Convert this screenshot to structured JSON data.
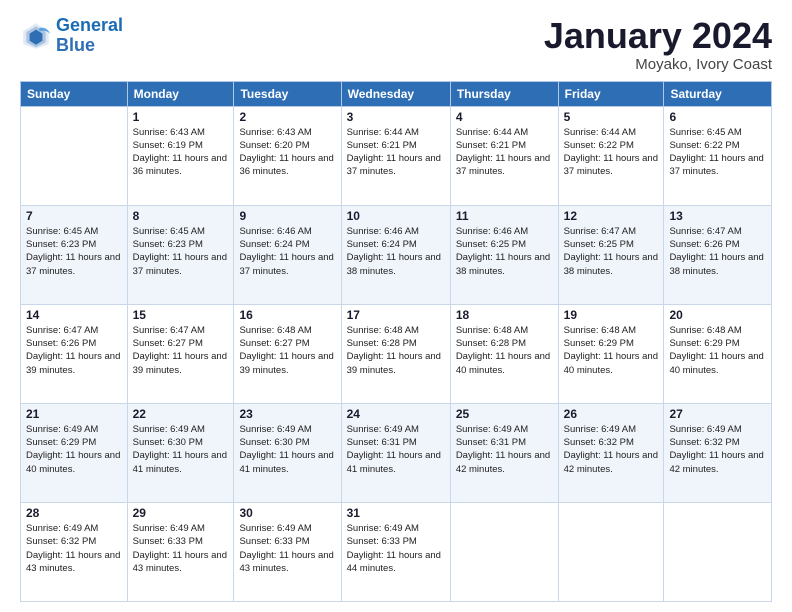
{
  "header": {
    "logo_line1": "General",
    "logo_line2": "Blue",
    "main_title": "January 2024",
    "subtitle": "Moyako, Ivory Coast"
  },
  "days_of_week": [
    "Sunday",
    "Monday",
    "Tuesday",
    "Wednesday",
    "Thursday",
    "Friday",
    "Saturday"
  ],
  "weeks": [
    [
      {
        "day": "",
        "sunrise": "",
        "sunset": "",
        "daylight": ""
      },
      {
        "day": "1",
        "sunrise": "Sunrise: 6:43 AM",
        "sunset": "Sunset: 6:19 PM",
        "daylight": "Daylight: 11 hours and 36 minutes."
      },
      {
        "day": "2",
        "sunrise": "Sunrise: 6:43 AM",
        "sunset": "Sunset: 6:20 PM",
        "daylight": "Daylight: 11 hours and 36 minutes."
      },
      {
        "day": "3",
        "sunrise": "Sunrise: 6:44 AM",
        "sunset": "Sunset: 6:21 PM",
        "daylight": "Daylight: 11 hours and 37 minutes."
      },
      {
        "day": "4",
        "sunrise": "Sunrise: 6:44 AM",
        "sunset": "Sunset: 6:21 PM",
        "daylight": "Daylight: 11 hours and 37 minutes."
      },
      {
        "day": "5",
        "sunrise": "Sunrise: 6:44 AM",
        "sunset": "Sunset: 6:22 PM",
        "daylight": "Daylight: 11 hours and 37 minutes."
      },
      {
        "day": "6",
        "sunrise": "Sunrise: 6:45 AM",
        "sunset": "Sunset: 6:22 PM",
        "daylight": "Daylight: 11 hours and 37 minutes."
      }
    ],
    [
      {
        "day": "7",
        "sunrise": "Sunrise: 6:45 AM",
        "sunset": "Sunset: 6:23 PM",
        "daylight": "Daylight: 11 hours and 37 minutes."
      },
      {
        "day": "8",
        "sunrise": "Sunrise: 6:45 AM",
        "sunset": "Sunset: 6:23 PM",
        "daylight": "Daylight: 11 hours and 37 minutes."
      },
      {
        "day": "9",
        "sunrise": "Sunrise: 6:46 AM",
        "sunset": "Sunset: 6:24 PM",
        "daylight": "Daylight: 11 hours and 37 minutes."
      },
      {
        "day": "10",
        "sunrise": "Sunrise: 6:46 AM",
        "sunset": "Sunset: 6:24 PM",
        "daylight": "Daylight: 11 hours and 38 minutes."
      },
      {
        "day": "11",
        "sunrise": "Sunrise: 6:46 AM",
        "sunset": "Sunset: 6:25 PM",
        "daylight": "Daylight: 11 hours and 38 minutes."
      },
      {
        "day": "12",
        "sunrise": "Sunrise: 6:47 AM",
        "sunset": "Sunset: 6:25 PM",
        "daylight": "Daylight: 11 hours and 38 minutes."
      },
      {
        "day": "13",
        "sunrise": "Sunrise: 6:47 AM",
        "sunset": "Sunset: 6:26 PM",
        "daylight": "Daylight: 11 hours and 38 minutes."
      }
    ],
    [
      {
        "day": "14",
        "sunrise": "Sunrise: 6:47 AM",
        "sunset": "Sunset: 6:26 PM",
        "daylight": "Daylight: 11 hours and 39 minutes."
      },
      {
        "day": "15",
        "sunrise": "Sunrise: 6:47 AM",
        "sunset": "Sunset: 6:27 PM",
        "daylight": "Daylight: 11 hours and 39 minutes."
      },
      {
        "day": "16",
        "sunrise": "Sunrise: 6:48 AM",
        "sunset": "Sunset: 6:27 PM",
        "daylight": "Daylight: 11 hours and 39 minutes."
      },
      {
        "day": "17",
        "sunrise": "Sunrise: 6:48 AM",
        "sunset": "Sunset: 6:28 PM",
        "daylight": "Daylight: 11 hours and 39 minutes."
      },
      {
        "day": "18",
        "sunrise": "Sunrise: 6:48 AM",
        "sunset": "Sunset: 6:28 PM",
        "daylight": "Daylight: 11 hours and 40 minutes."
      },
      {
        "day": "19",
        "sunrise": "Sunrise: 6:48 AM",
        "sunset": "Sunset: 6:29 PM",
        "daylight": "Daylight: 11 hours and 40 minutes."
      },
      {
        "day": "20",
        "sunrise": "Sunrise: 6:48 AM",
        "sunset": "Sunset: 6:29 PM",
        "daylight": "Daylight: 11 hours and 40 minutes."
      }
    ],
    [
      {
        "day": "21",
        "sunrise": "Sunrise: 6:49 AM",
        "sunset": "Sunset: 6:29 PM",
        "daylight": "Daylight: 11 hours and 40 minutes."
      },
      {
        "day": "22",
        "sunrise": "Sunrise: 6:49 AM",
        "sunset": "Sunset: 6:30 PM",
        "daylight": "Daylight: 11 hours and 41 minutes."
      },
      {
        "day": "23",
        "sunrise": "Sunrise: 6:49 AM",
        "sunset": "Sunset: 6:30 PM",
        "daylight": "Daylight: 11 hours and 41 minutes."
      },
      {
        "day": "24",
        "sunrise": "Sunrise: 6:49 AM",
        "sunset": "Sunset: 6:31 PM",
        "daylight": "Daylight: 11 hours and 41 minutes."
      },
      {
        "day": "25",
        "sunrise": "Sunrise: 6:49 AM",
        "sunset": "Sunset: 6:31 PM",
        "daylight": "Daylight: 11 hours and 42 minutes."
      },
      {
        "day": "26",
        "sunrise": "Sunrise: 6:49 AM",
        "sunset": "Sunset: 6:32 PM",
        "daylight": "Daylight: 11 hours and 42 minutes."
      },
      {
        "day": "27",
        "sunrise": "Sunrise: 6:49 AM",
        "sunset": "Sunset: 6:32 PM",
        "daylight": "Daylight: 11 hours and 42 minutes."
      }
    ],
    [
      {
        "day": "28",
        "sunrise": "Sunrise: 6:49 AM",
        "sunset": "Sunset: 6:32 PM",
        "daylight": "Daylight: 11 hours and 43 minutes."
      },
      {
        "day": "29",
        "sunrise": "Sunrise: 6:49 AM",
        "sunset": "Sunset: 6:33 PM",
        "daylight": "Daylight: 11 hours and 43 minutes."
      },
      {
        "day": "30",
        "sunrise": "Sunrise: 6:49 AM",
        "sunset": "Sunset: 6:33 PM",
        "daylight": "Daylight: 11 hours and 43 minutes."
      },
      {
        "day": "31",
        "sunrise": "Sunrise: 6:49 AM",
        "sunset": "Sunset: 6:33 PM",
        "daylight": "Daylight: 11 hours and 44 minutes."
      },
      {
        "day": "",
        "sunrise": "",
        "sunset": "",
        "daylight": ""
      },
      {
        "day": "",
        "sunrise": "",
        "sunset": "",
        "daylight": ""
      },
      {
        "day": "",
        "sunrise": "",
        "sunset": "",
        "daylight": ""
      }
    ]
  ]
}
